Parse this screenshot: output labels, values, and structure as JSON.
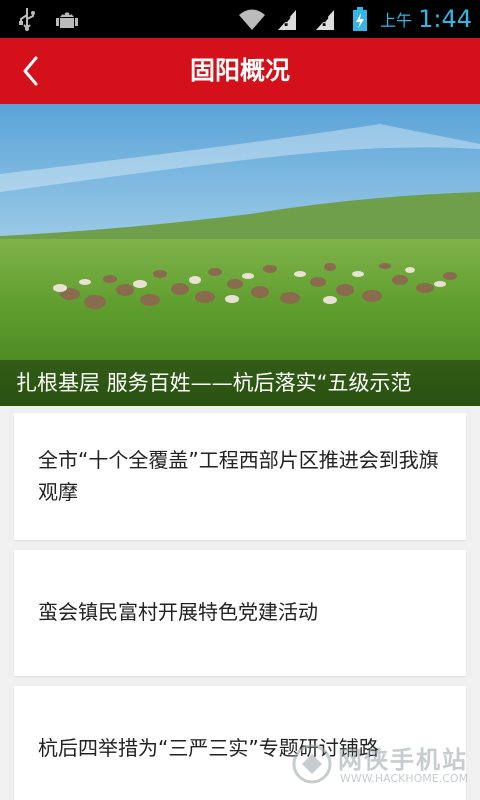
{
  "status_bar": {
    "time": "1:44",
    "ampm": "上午",
    "icons": [
      "usb-icon",
      "android-debug-icon",
      "wifi-icon",
      "unknown-signal-icon",
      "unknown-signal-icon",
      "battery-charging-icon"
    ]
  },
  "header": {
    "title": "固阳概况",
    "back_icon": "chevron-left-icon",
    "background_color": "#d4111b"
  },
  "hero": {
    "caption": "扎根基层 服务百姓——杭后落实“五级示范"
  },
  "news": [
    {
      "title": "全市“十个全覆盖”工程西部片区推进会到我旗观摩"
    },
    {
      "title": "蛮会镇民富村开展特色党建活动"
    },
    {
      "title": "杭后四举措为“三严三实”专题研讨铺路"
    }
  ],
  "watermark": {
    "cn": "网侠手机站",
    "en": "WWW.HACKHOME.COM"
  }
}
